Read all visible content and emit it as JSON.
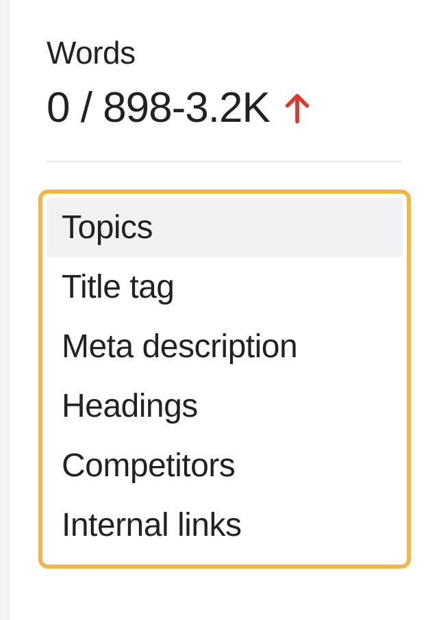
{
  "words": {
    "label": "Words",
    "value": "0 / 898-3.2K"
  },
  "menu": {
    "items": [
      {
        "label": "Topics",
        "active": true
      },
      {
        "label": "Title tag",
        "active": false
      },
      {
        "label": "Meta description",
        "active": false
      },
      {
        "label": "Headings",
        "active": false
      },
      {
        "label": "Competitors",
        "active": false
      },
      {
        "label": "Internal links",
        "active": false
      }
    ]
  }
}
